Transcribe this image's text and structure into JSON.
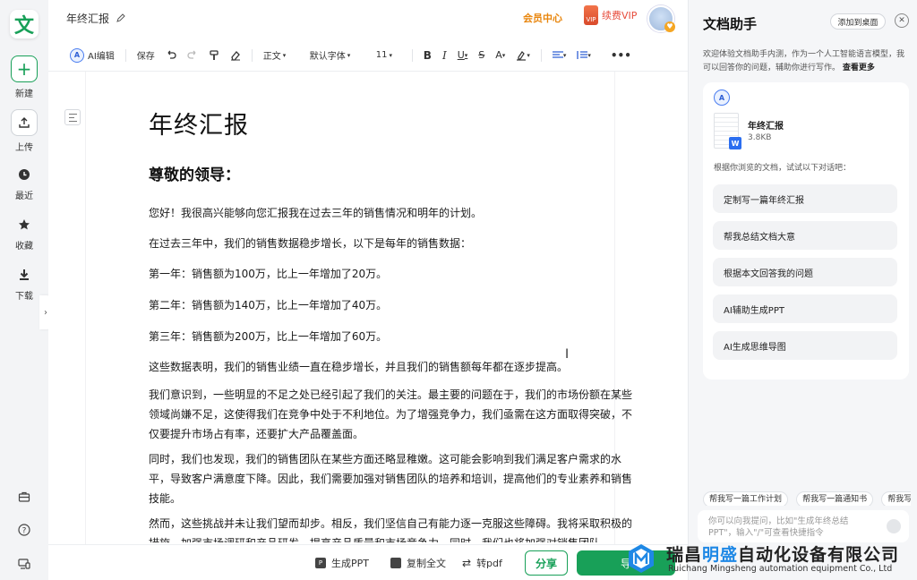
{
  "app": {
    "logo_char": "文",
    "brand_color": "#18a058"
  },
  "rail": {
    "new": "新建",
    "upload": "上传",
    "recent": "最近",
    "favorites": "收藏",
    "download": "下载"
  },
  "header": {
    "doc_title": "年终汇报",
    "member_center": "会员中心",
    "vip_badge": "VIP",
    "renew_vip": "续费VIP"
  },
  "toolbar": {
    "ai_edit": "AI编辑",
    "save": "保存",
    "paragraph_style": "正文",
    "font_family": "默认字体",
    "font_size": "11",
    "more": "•••"
  },
  "document": {
    "title": "年终汇报",
    "greeting": "尊敬的领导：",
    "paragraphs": [
      "您好！我很高兴能够向您汇报我在过去三年的销售情况和明年的计划。",
      "在过去三年中，我们的销售数据稳步增长，以下是每年的销售数据：",
      "第一年：销售额为100万，比上一年增加了20万。",
      "第二年：销售额为140万，比上一年增加了40万。",
      "第三年：销售额为200万，比上一年增加了60万。",
      "这些数据表明，我们的销售业绩一直在稳步增长，并且我们的销售额每年都在逐步提高。",
      "我们意识到，一些明显的不足之处已经引起了我们的关注。最主要的问题在于，我们的市场份额在某些领域尚嫌不足，这使得我们在竞争中处于不利地位。为了增强竞争力，我们亟需在这方面取得突破，不仅要提升市场占有率，还要扩大产品覆盖面。",
      "同时，我们也发现，我们的销售团队在某些方面还略显稚嫩。这可能会影响到我们满足客户需求的水平，导致客户满意度下降。因此，我们需要加强对销售团队的培养和培训，提高他们的专业素养和销售技能。",
      "然而，这些挑战并未让我们望而却步。相反，我们坚信自己有能力逐一克服这些障碍。我将采取积极的措施，加强市场调研和产品研发，提高产品质量和市场竞争力。同时，我们也将加强对销售团队"
    ]
  },
  "bottom_bar": {
    "gen_ppt": "生成PPT",
    "copy_all": "复制全文",
    "to_pdf": "转pdf",
    "share": "分享",
    "primary_partial": "导"
  },
  "panel": {
    "title": "文档助手",
    "add_to_desktop": "添加到桌面",
    "welcome": "欢迎体验文档助手内测，作为一个人工智能语言模型，我可以回答你的问题，辅助你进行写作。",
    "see_more": "查看更多",
    "ai_badge": "A",
    "file_name": "年终汇报",
    "file_size": "3.8KB",
    "file_type_badge": "W",
    "suggest_hint": "根据你浏览的文档，试试以下对话吧：",
    "suggestions": [
      "定制写一篇年终汇报",
      "帮我总结文档大意",
      "根据本文回答我的问题",
      "AI辅助生成PPT",
      "AI生成思维导图"
    ],
    "chips": [
      "帮我写一篇工作计划",
      "帮我写一篇通知书",
      "帮我写一"
    ],
    "input_placeholder": "你可以向我提问，比如\"生成年终总结PPT\"，输入\"/\"可查看快捷指令"
  },
  "watermark": {
    "company_cn_pre": "瑞昌",
    "company_cn_accent": "明盛",
    "company_cn_post": "自动化设备有限公司",
    "company_en": "Ruichang Mingsheng automation equipment Co., Ltd"
  }
}
